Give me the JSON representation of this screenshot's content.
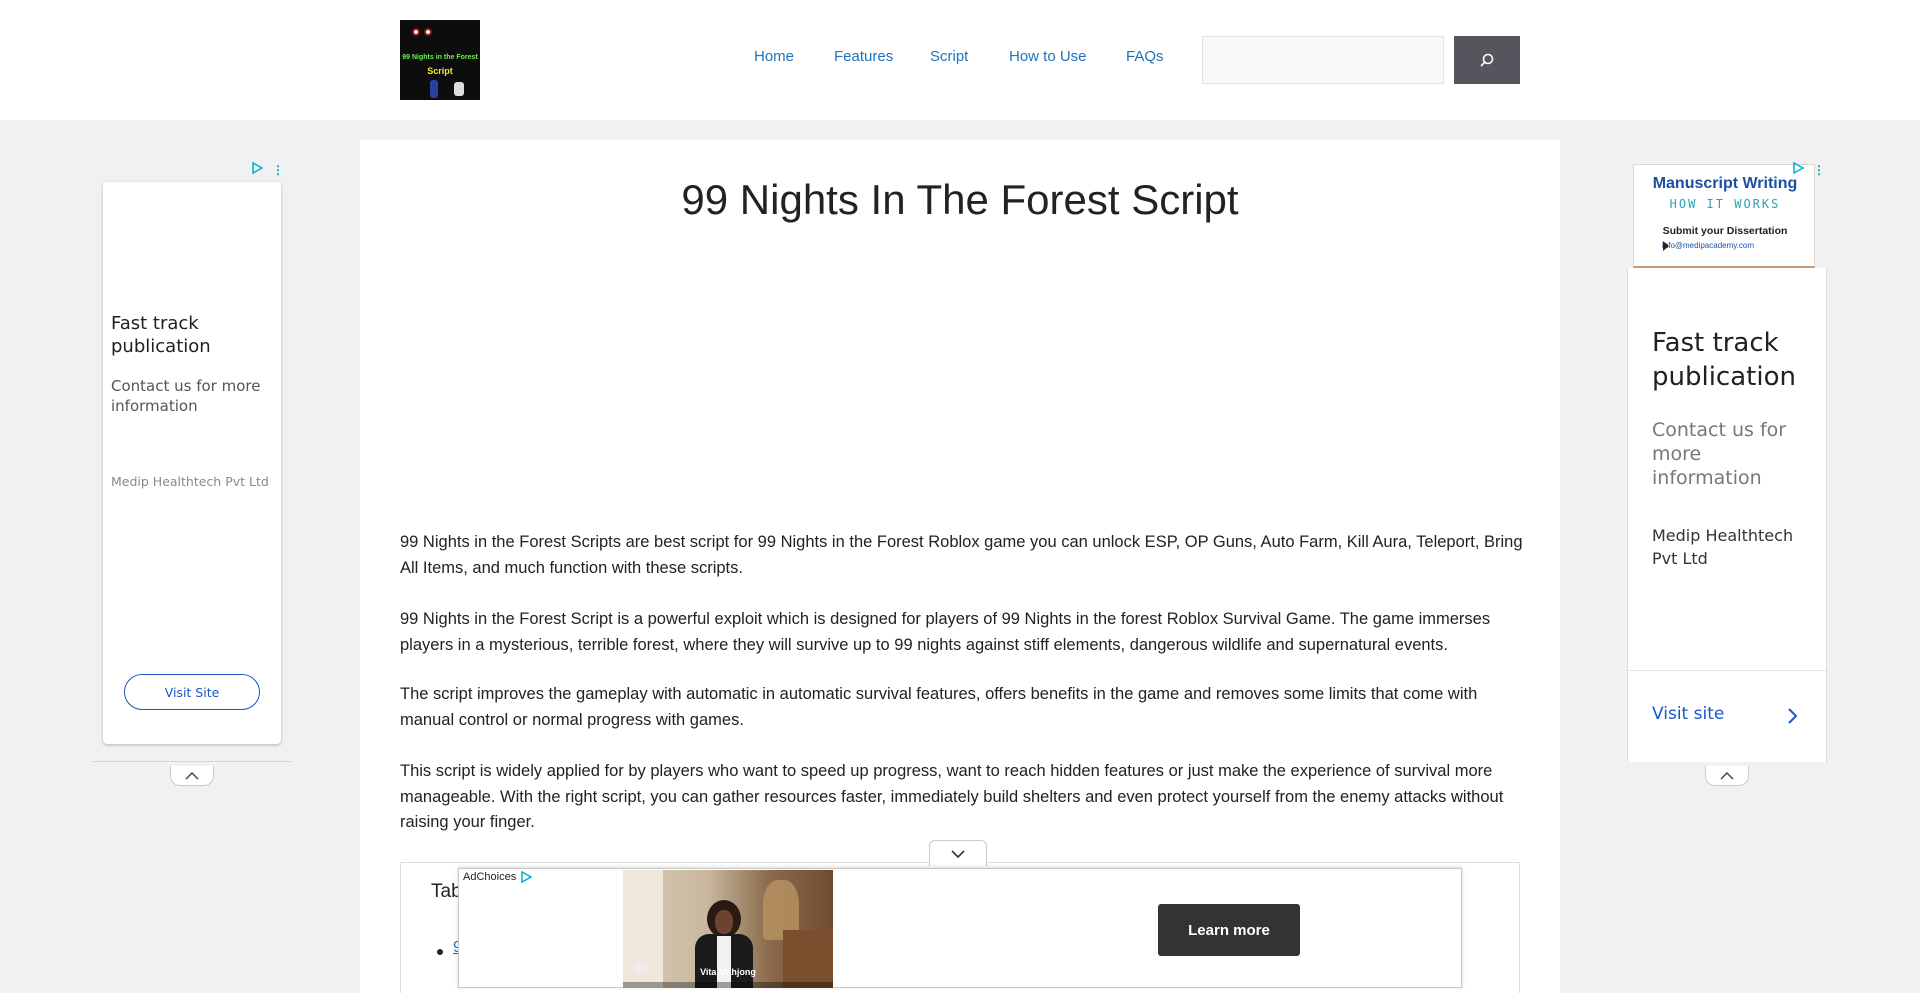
{
  "header": {
    "logo": {
      "line1": "99 Nights in the Forest",
      "line2": "Script"
    },
    "nav": [
      {
        "label": "Home"
      },
      {
        "label": "Features"
      },
      {
        "label": "Script"
      },
      {
        "label": "How to Use"
      },
      {
        "label": "FAQs"
      }
    ],
    "search": {
      "placeholder": "",
      "value": "",
      "icon": "search-icon"
    }
  },
  "article": {
    "title": "99 Nights In The Forest Script",
    "paragraphs": [
      "99 Nights in the Forest Scripts are best script for 99 Nights in the Forest Roblox game you can unlock ESP, OP Guns, Auto Farm, Kill Aura, Teleport, Bring All Items, and much function with these scripts.",
      "99 Nights in the Forest Script is a powerful exploit which is designed for players of 99 Nights in the forest Roblox Survival Game. The game immerses players in a mysterious, terrible forest, where they will survive up to 99 nights against stiff elements, dangerous wildlife and supernatural events.",
      "The script improves the gameplay with automatic in automatic survival features, offers benefits in the game and removes some limits that come with manual control or normal progress with games.",
      "This script is widely applied for by players who want to speed up progress, want to reach hidden features or just make the experience of survival more manageable. With the right script, you can gather resources faster, immediately build shelters and even protect yourself from the enemy attacks without raising your finger."
    ],
    "toc": {
      "title": "Tab",
      "first_item": "9"
    }
  },
  "left_ad": {
    "headline": "Fast track publication",
    "body": "Contact us for more information",
    "advertiser": "Medip Healthtech Pvt Ltd",
    "cta": "Visit Site"
  },
  "right_ad": {
    "banner_title": "Manuscript Writing",
    "banner_subtitle": "HOW IT WORKS",
    "banner_line": "Submit your Dissertation",
    "banner_email": "info@medipacademy.com",
    "headline": "Fast track publication",
    "body": "Contact us for more information",
    "advertiser": "Medip Healthtech Pvt Ltd",
    "cta": "Visit site"
  },
  "bottom_ad": {
    "adchoices": "AdChoices",
    "video_caption": "Vita Mahjong",
    "cta": "Learn more"
  },
  "colors": {
    "link": "#1e72bd",
    "search_button": "#55555e",
    "ad_accent": "#00aecd",
    "cta_dark": "#333333"
  }
}
